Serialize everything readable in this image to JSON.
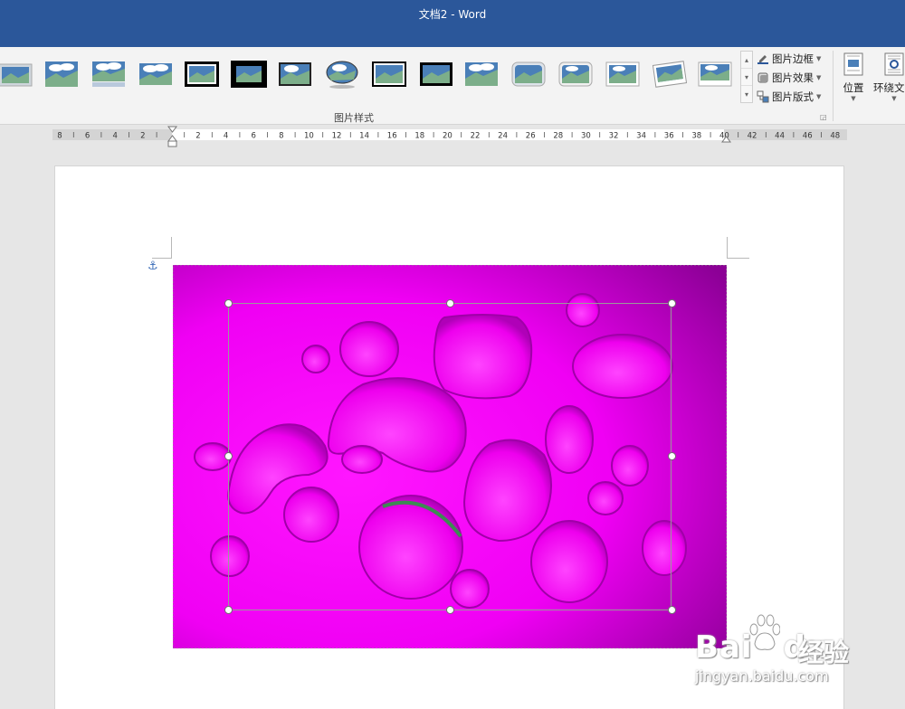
{
  "titlebar": {
    "title": "文档2 - Word"
  },
  "ribbon": {
    "group_label": "图片样式",
    "picture_border": "图片边框",
    "picture_effects": "图片效果",
    "picture_layout": "图片版式",
    "position": "位置",
    "wrap_text": "环绕文字"
  },
  "ruler": {
    "labels": [
      "8",
      "6",
      "4",
      "2",
      "",
      "2",
      "4",
      "6",
      "8",
      "10",
      "12",
      "14",
      "16",
      "18",
      "20",
      "22",
      "24",
      "26",
      "28",
      "30",
      "32",
      "34",
      "36",
      "38",
      "40",
      "42",
      "44",
      "46",
      "48"
    ]
  },
  "colors": {
    "title_bar": "#2b579a",
    "magenta": "#ff00ff",
    "magenta_dark": "#8c0096"
  },
  "watermark": {
    "brand": "Bai",
    "brand2": "du",
    "cn": "经验",
    "site": "jingyan.baidu.com"
  }
}
